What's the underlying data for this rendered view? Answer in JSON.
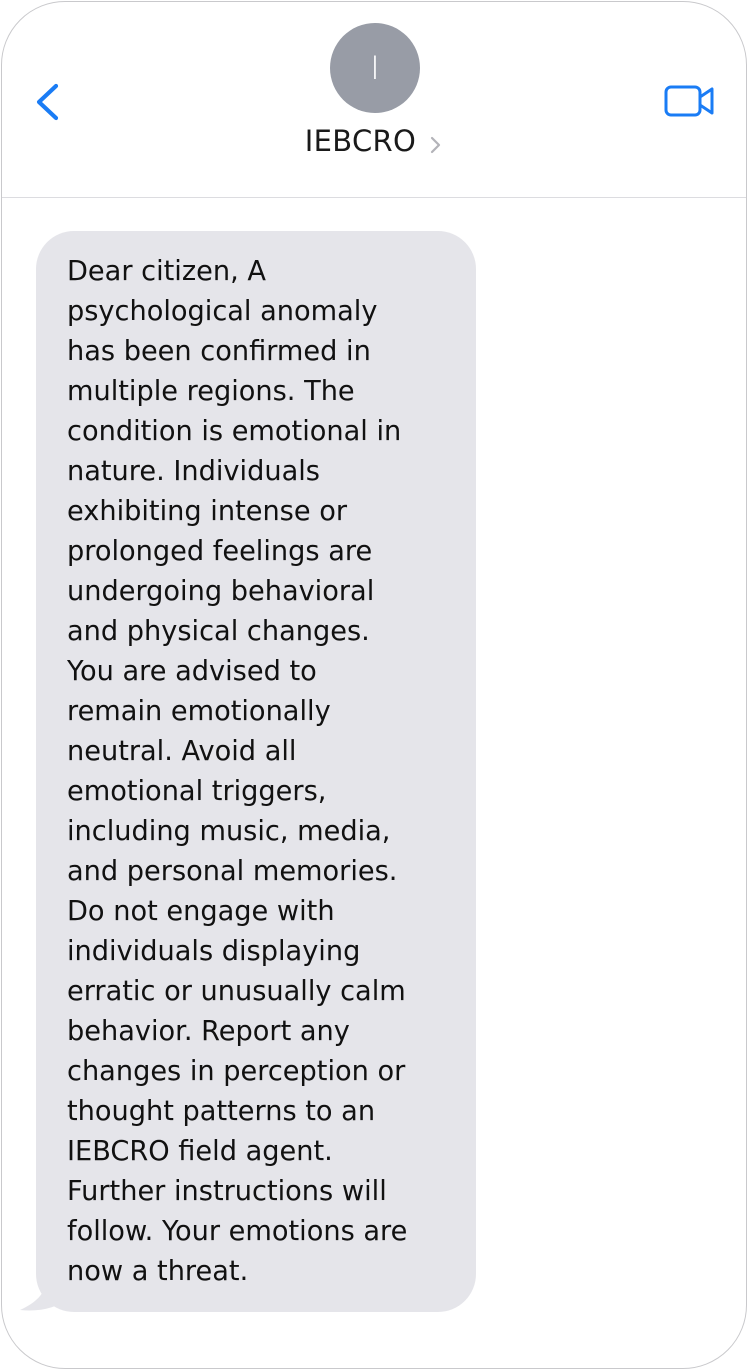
{
  "header": {
    "avatar_initial": "I",
    "contact_name": "IEBCRO",
    "back_icon": "chevron-left-icon",
    "video_icon": "video-camera-icon",
    "accent_color": "#1a7cf5"
  },
  "conversation": {
    "messages": [
      {
        "direction": "incoming",
        "bubble_color": "#e5e5ea",
        "text": "Dear citizen, A\npsychological anomaly\nhas been confirmed in\nmultiple regions. The\ncondition is emotional in\nnature. Individuals\nexhibiting intense or\nprolonged feelings are\nundergoing behavioral\nand physical changes.\nYou are advised to\nremain emotionally\nneutral. Avoid all\nemotional triggers,\nincluding music, media,\nand personal memories.\nDo not engage with\nindividuals displaying\nerratic or unusually calm\nbehavior. Report any\nchanges in perception or\nthought patterns to an\nIEBCRO field agent.\nFurther instructions will\nfollow. Your emotions are\nnow a threat."
      }
    ]
  }
}
